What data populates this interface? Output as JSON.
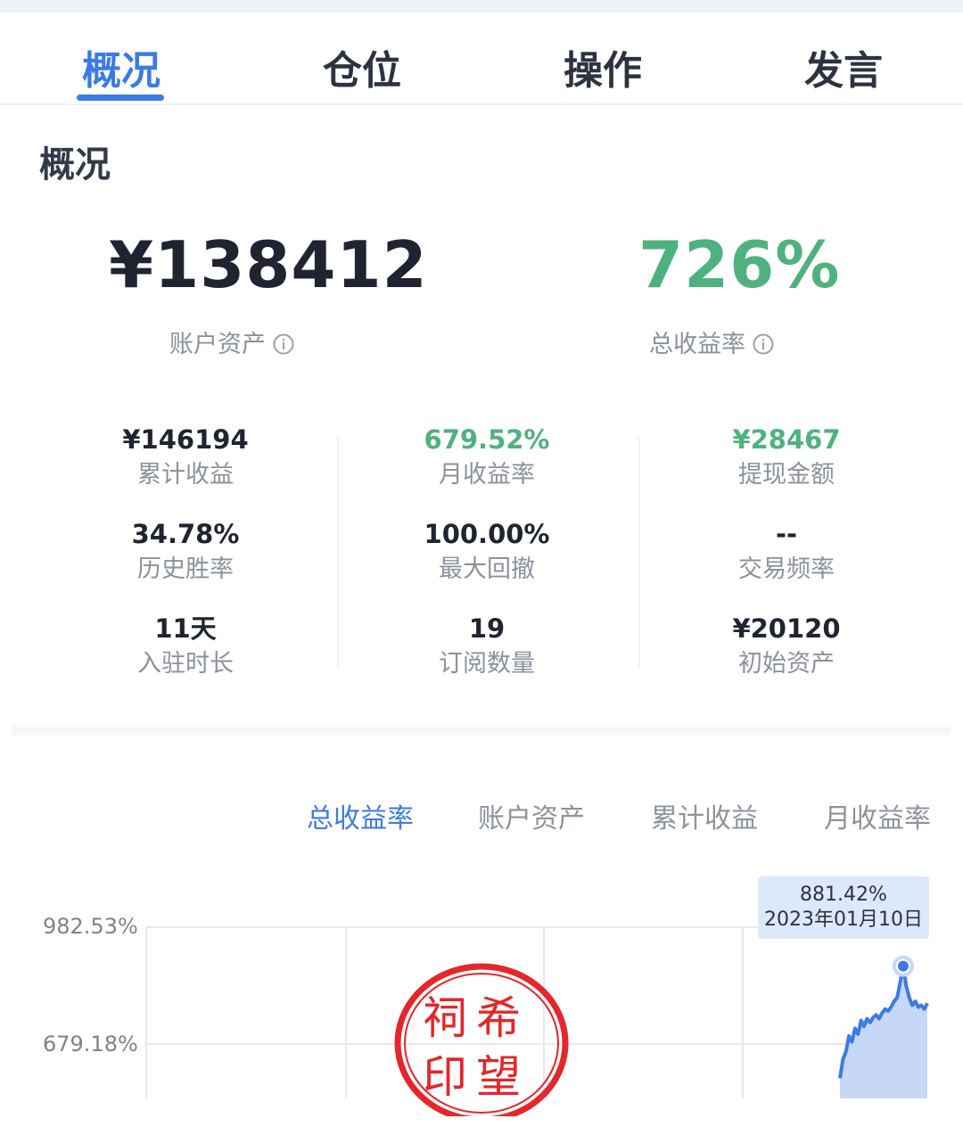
{
  "tabs": [
    "概况",
    "仓位",
    "操作",
    "发言"
  ],
  "active_tab": "概况",
  "section_title": "概况",
  "account_assets": {
    "value": "¥138412",
    "label": "账户资产"
  },
  "total_return": {
    "value": "726%",
    "label": "总收益率"
  },
  "stats": [
    {
      "value": "¥146194",
      "label": "累计收益",
      "color": "#1f2430"
    },
    {
      "value": "679.52%",
      "label": "月收益率",
      "color": "#4fb27e"
    },
    {
      "value": "¥28467",
      "label": "提现金额",
      "color": "#4fb27e"
    },
    {
      "value": "34.78%",
      "label": "历史胜率",
      "color": "#1f2430"
    },
    {
      "value": "100.00%",
      "label": "最大回撤",
      "color": "#1f2430"
    },
    {
      "value": "--",
      "label": "交易频率",
      "color": "#1f2430"
    },
    {
      "value": "11天",
      "label": "入驻时长",
      "color": "#1f2430"
    },
    {
      "value": "19",
      "label": "订阅数量",
      "color": "#1f2430"
    },
    {
      "value": "¥20120",
      "label": "初始资产",
      "color": "#1f2430"
    }
  ],
  "chart_tabs": [
    "总收益率",
    "账户资产",
    "累计收益",
    "月收益率"
  ],
  "active_chart_tab": "总收益率",
  "tooltip": {
    "value": "881.42%",
    "date": "2023年01月10日"
  },
  "watermark": {
    "line1": "祠希",
    "line2": "印望"
  },
  "colors": {
    "accent": "#3b7be4",
    "positive": "#4fb27e",
    "text": "#1f2430",
    "muted": "#8b919c",
    "stamp": "#e5262a"
  },
  "chart_data": {
    "type": "area",
    "title": "",
    "xlabel": "",
    "ylabel": "",
    "y_ticks": [
      "982.53%",
      "679.18%"
    ],
    "ylim": [
      580,
      982.53
    ],
    "series": [
      {
        "values": [
          590,
          640,
          660,
          700,
          685,
          720,
          705,
          740,
          725,
          745,
          735,
          748,
          755,
          745,
          760,
          770,
          765,
          775,
          790,
          800,
          840,
          881.42,
          830,
          800,
          780,
          790,
          775,
          780,
          770,
          785
        ]
      }
    ],
    "highlight": {
      "value": 881.42,
      "label": "881.42%",
      "date": "2023年01月10日"
    }
  }
}
